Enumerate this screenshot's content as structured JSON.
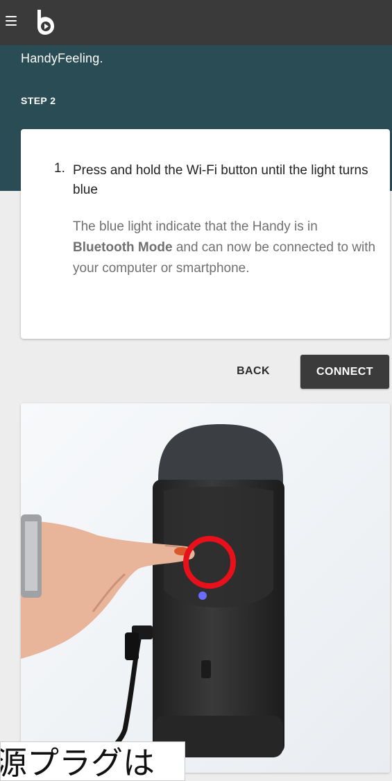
{
  "intro": {
    "text": "HandyFeeling."
  },
  "step": {
    "label": "STEP 2"
  },
  "instruction": {
    "number": "1.",
    "title": "Press and hold the Wi-Fi button until the light turns blue",
    "desc_before": "The blue light indicate that the Handy is in ",
    "desc_bold": "Bluetooth Mode",
    "desc_after": " and can now be connected to with your computer or smartphone."
  },
  "actions": {
    "back_label": "BACK",
    "connect_label": "CONNECT"
  },
  "caption": {
    "text": "源プラグは"
  },
  "icons": {
    "menu": "menu-icon",
    "logo": "handy-logo-icon",
    "indicator": "blue-light-indicator"
  },
  "colors": {
    "top_bar": "#3a3a3a",
    "header_band": "#2a4d55",
    "connect_button": "#3b3b3b",
    "highlight_circle": "#e8101a",
    "indicator_light": "#6b6bff"
  }
}
